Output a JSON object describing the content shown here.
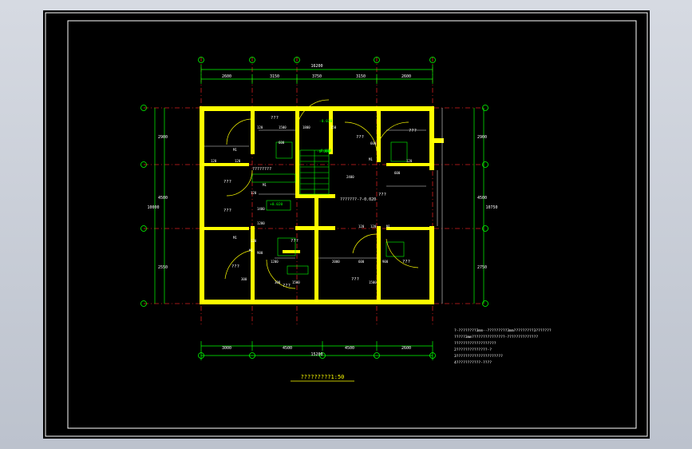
{
  "drawing": {
    "title": "?????????1:50",
    "overall_top_dim": "16200",
    "overall_bottom_dim": "15200",
    "overall_left_dim": "10000",
    "overall_right_dim": "10750",
    "top_dims": [
      "2600",
      "3150",
      "3750",
      "3150",
      "2600"
    ],
    "bottom_dims": [
      "3000",
      "4500",
      "4500",
      "2600"
    ],
    "left_dims": [
      "2900",
      "4500",
      "2550"
    ],
    "right_dims": [
      "2900",
      "4500",
      "2750"
    ],
    "room_labels": [
      "???",
      "???",
      "???",
      "???",
      "???",
      "???",
      "???",
      "???",
      "???",
      "???",
      "???"
    ],
    "elevations": [
      "-0.000",
      "-0.020",
      "+0.020",
      "-0.020"
    ],
    "door_tags": [
      "M1",
      "M1",
      "M1",
      "M1",
      "M1",
      "M1"
    ],
    "stair_label": "????????",
    "stair_label_2": "???????-?-0.020",
    "interior_dims": [
      "120",
      "120",
      "1500",
      "120",
      "600",
      "1800",
      "150",
      "600",
      "120",
      "2400",
      "120",
      "1400",
      "600",
      "120",
      "1200",
      "300",
      "120",
      "900",
      "1500",
      "2000",
      "600",
      "900",
      "120",
      "1200",
      "1500",
      "300"
    ],
    "notes": [
      "?-????????3mm--?????????3mm?????????3???????",
      "  ?????3mm???????????????-??????????????",
      "  ???????????????????",
      "  2??????????????-?",
      "  3?????????????????????",
      "  4???????????-????"
    ]
  }
}
